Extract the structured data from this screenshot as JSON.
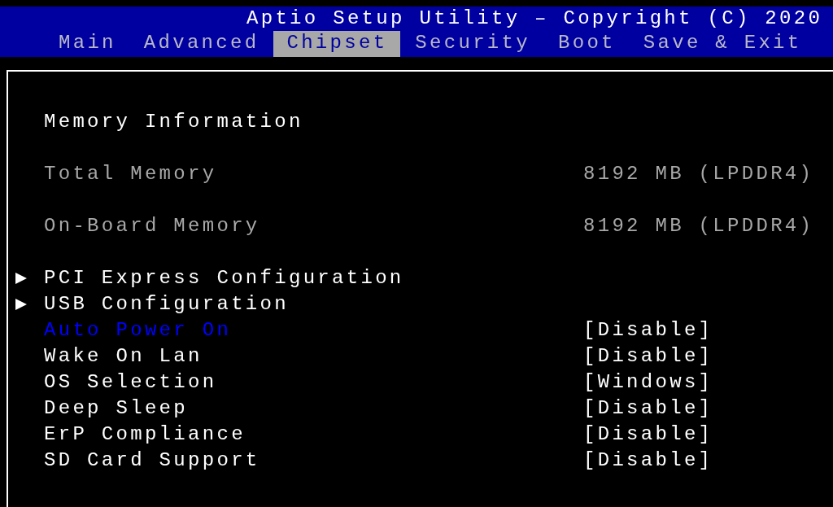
{
  "window": {
    "title": "Aptio Setup Utility – Copyright (C) 2020"
  },
  "tabs": [
    {
      "label": "Main",
      "selected": false
    },
    {
      "label": "Advanced",
      "selected": false
    },
    {
      "label": "Chipset",
      "selected": true
    },
    {
      "label": "Security",
      "selected": false
    },
    {
      "label": "Boot",
      "selected": false
    },
    {
      "label": "Save & Exit",
      "selected": false
    }
  ],
  "panel": {
    "rows": [
      {
        "kind": "heading",
        "label": "Memory Information"
      },
      {
        "kind": "info",
        "label": "Total Memory",
        "value": "8192 MB (LPDDR4)"
      },
      {
        "kind": "info",
        "label": "On-Board Memory",
        "value": "8192 MB (LPDDR4)"
      },
      {
        "kind": "submenu",
        "label": "PCI Express Configuration"
      },
      {
        "kind": "submenu",
        "label": "USB Configuration"
      },
      {
        "kind": "setting",
        "label": "Auto Power On",
        "value": "[Disable]",
        "selected": true
      },
      {
        "kind": "setting",
        "label": "Wake On Lan",
        "value": "[Disable]",
        "selected": false
      },
      {
        "kind": "setting",
        "label": "OS Selection",
        "value": "[Windows]",
        "selected": false
      },
      {
        "kind": "setting",
        "label": "Deep Sleep",
        "value": "[Disable]",
        "selected": false
      },
      {
        "kind": "setting",
        "label": "ErP Compliance",
        "value": "[Disable]",
        "selected": false
      },
      {
        "kind": "setting",
        "label": "SD Card Support",
        "value": "[Disable]",
        "selected": false
      }
    ]
  }
}
